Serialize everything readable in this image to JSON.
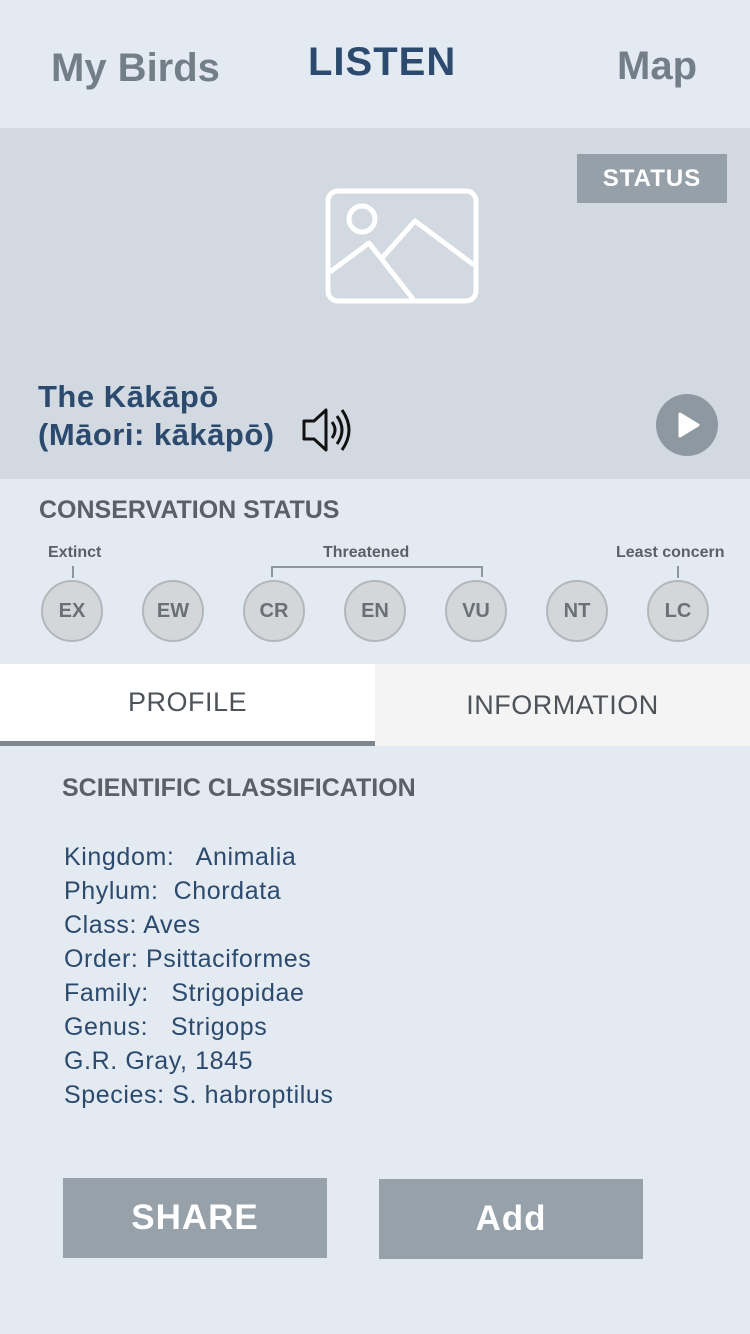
{
  "nav": {
    "my_birds": "My Birds",
    "listen": "LISTEN",
    "map": "Map"
  },
  "hero": {
    "status_label": "STATUS",
    "name_line1": "The Kākāpō",
    "name_line2": "(Māori: kākāpō)",
    "icons": {
      "image": "image-placeholder-icon",
      "speaker": "speaker-icon",
      "play": "play-icon"
    }
  },
  "conservation": {
    "title": "CONSERVATION STATUS",
    "group_labels": {
      "extinct": "Extinct",
      "threatened": "Threatened",
      "least": "Least concern"
    },
    "levels": [
      "EX",
      "EW",
      "CR",
      "EN",
      "VU",
      "NT",
      "LC"
    ]
  },
  "tabs": {
    "profile": "PROFILE",
    "information": "INFORMATION",
    "active": "PROFILE"
  },
  "classification": {
    "title": "SCIENTIFIC CLASSIFICATION",
    "rows": [
      "Kingdom:   Animalia",
      "Phylum:  Chordata",
      "Class: Aves",
      "Order: Psittaciformes",
      "Family:   Strigopidae",
      "Genus:   Strigops",
      "G.R. Gray, 1845",
      "Species: S. habroptilus"
    ]
  },
  "buttons": {
    "share": "SHARE",
    "add": "Add"
  },
  "colors": {
    "accent": "#2b4a6e",
    "muted": "#737f88",
    "button": "#97a1aa",
    "background": "#e4eaf1"
  }
}
